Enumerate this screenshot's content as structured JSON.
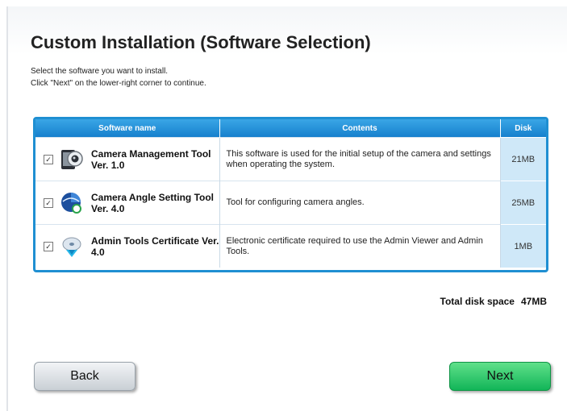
{
  "title": "Custom Installation (Software Selection)",
  "instructions": {
    "line1": "Select the software you want to install.",
    "line2": "Click \"Next\" on the lower-right corner to continue."
  },
  "table": {
    "headers": {
      "name": "Software name",
      "contents": "Contents",
      "disk": "Disk"
    },
    "rows": [
      {
        "checked": true,
        "icon": "camera-management-icon",
        "name": "Camera Management Tool Ver. 1.0",
        "contents": "This software is used for the initial setup of the camera and settings when operating the system.",
        "disk": "21MB"
      },
      {
        "checked": true,
        "icon": "camera-angle-icon",
        "name": "Camera Angle Setting Tool Ver. 4.0",
        "contents": "Tool for configuring camera angles.",
        "disk": "25MB"
      },
      {
        "checked": true,
        "icon": "certificate-disc-icon",
        "name": "Admin Tools Certificate Ver. 4.0",
        "contents": "Electronic certificate required to use the Admin Viewer and Admin Tools.",
        "disk": "1MB"
      }
    ]
  },
  "total": {
    "label": "Total disk space",
    "value": "47MB"
  },
  "buttons": {
    "back": "Back",
    "next": "Next"
  },
  "colors": {
    "header_blue": "#1f8fd2",
    "disk_cell": "#cfe8f8",
    "next_green": "#12b558"
  }
}
